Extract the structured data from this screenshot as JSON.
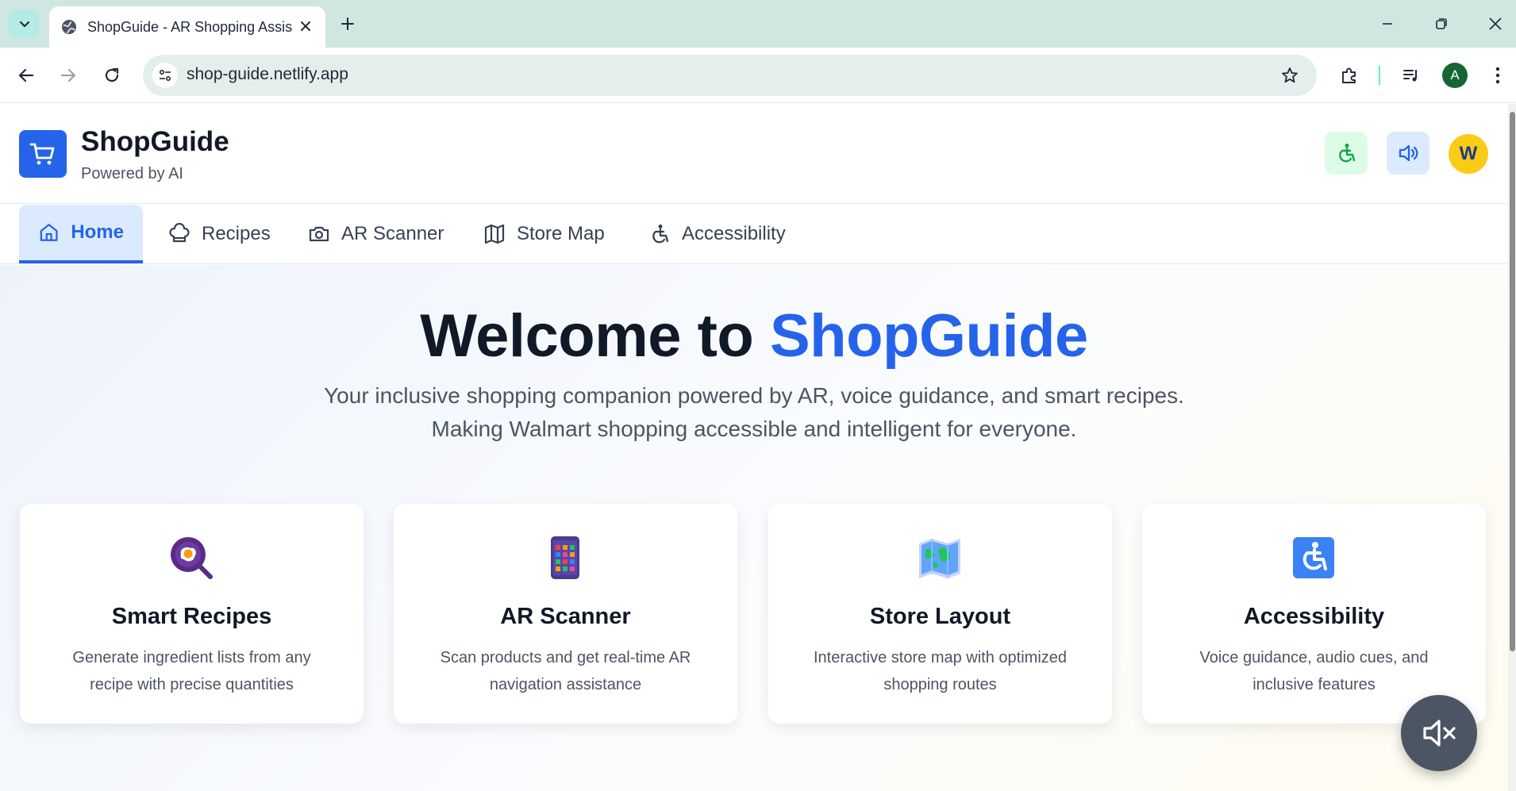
{
  "browser": {
    "tab_title": "ShopGuide - AR Shopping Assis",
    "url": "shop-guide.netlify.app",
    "profile_initial": "A",
    "icons": [
      "tab-search-icon",
      "globe-icon",
      "close-icon",
      "plus-icon",
      "minimize-icon",
      "restore-icon",
      "window-close-icon",
      "back-icon",
      "forward-icon",
      "reload-icon",
      "site-info-icon",
      "star-icon",
      "extensions-icon",
      "media-icon"
    ]
  },
  "header": {
    "brand_title": "ShopGuide",
    "brand_subtitle": "Powered by AI",
    "avatar_initial": "W",
    "icons": [
      "cart-icon",
      "accessibility-icon",
      "volume-icon"
    ],
    "colors": {
      "brand": "#2563eb",
      "accessibility_bg": "#dcfce7",
      "volume_bg": "#dbeafe",
      "avatar_bg": "#facc15"
    }
  },
  "nav": {
    "items": [
      {
        "label": "Home",
        "icon": "home-icon",
        "active": true
      },
      {
        "label": "Recipes",
        "icon": "chef-hat-icon",
        "active": false
      },
      {
        "label": "AR Scanner",
        "icon": "camera-icon",
        "active": false
      },
      {
        "label": "Store Map",
        "icon": "map-icon",
        "active": false
      },
      {
        "label": "Accessibility",
        "icon": "accessibility-icon",
        "active": false
      }
    ]
  },
  "hero": {
    "title_prefix": "Welcome to ",
    "title_accent": "ShopGuide",
    "subtitle_line1": "Your inclusive shopping companion powered by AR, voice guidance, and smart recipes.",
    "subtitle_line2": "Making Walmart shopping accessible and intelligent for everyone."
  },
  "features": [
    {
      "title": "Smart Recipes",
      "description": "Generate ingredient lists from any recipe with precise quantities",
      "icon": "frying-pan-icon"
    },
    {
      "title": "AR Scanner",
      "description": "Scan products and get real-time AR navigation assistance",
      "icon": "mobile-phone-icon"
    },
    {
      "title": "Store Layout",
      "description": "Interactive store map with optimized shopping routes",
      "icon": "world-map-icon"
    },
    {
      "title": "Accessibility",
      "description": "Voice guidance, audio cues, and inclusive features",
      "icon": "wheelchair-icon"
    }
  ],
  "mute_button": {
    "icon": "volume-mute-icon"
  }
}
